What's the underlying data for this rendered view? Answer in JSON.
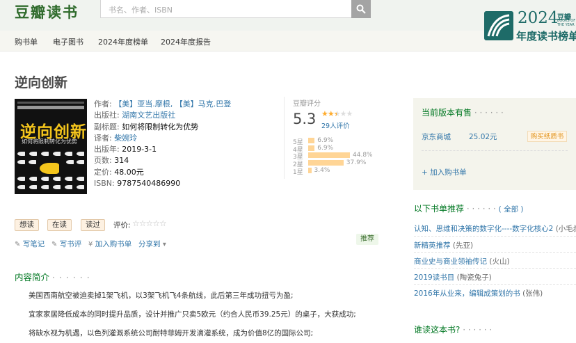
{
  "header": {
    "logo": "豆瓣读书",
    "search_placeholder": "书名、作者、ISBN",
    "nav": [
      "购书单",
      "电子图书",
      "2024年度榜单",
      "2024年度报告"
    ],
    "banner": {
      "year": "2024",
      "subtitle": "年度读书榜单",
      "brand": "豆瓣",
      "brand_sub": "BOOKS OF THE YEAR"
    }
  },
  "book": {
    "title": "逆向创新",
    "cover": {
      "title": "逆向创新",
      "subtitle": "如何将限制转化为优势"
    },
    "author_label": "作者:",
    "author": "【美】亚当.摩根, 【美】马克.巴登",
    "publisher_label": "出版社:",
    "publisher": "湖南文艺出版社",
    "subtitle_label": "副标题:",
    "subtitle": "如何将限制转化为优势",
    "translator_label": "译者:",
    "translator": "柴婉玲",
    "pubdate_label": "出版年:",
    "pubdate": "2019-3-1",
    "pages_label": "页数:",
    "pages": "314",
    "price_label": "定价:",
    "price": "48.00元",
    "isbn_label": "ISBN:",
    "isbn": "9787540486990"
  },
  "rating": {
    "title": "豆瓣评分",
    "score": "5.3",
    "stars_value": 2.5,
    "count": "29人评价",
    "distribution": [
      {
        "label": "5星",
        "value": 6.9,
        "pct": "6.9%"
      },
      {
        "label": "4星",
        "value": 6.9,
        "pct": "6.9%"
      },
      {
        "label": "3星",
        "value": 44.8,
        "pct": "44.8%"
      },
      {
        "label": "2星",
        "value": 37.9,
        "pct": "37.9%"
      },
      {
        "label": "1星",
        "value": 3.4,
        "pct": "3.4%"
      }
    ]
  },
  "actions": {
    "want": "想读",
    "reading": "在读",
    "read": "读过",
    "rate_label": "评价:",
    "write_note": "写笔记",
    "write_review": "写书评",
    "add_list": "加入购书单",
    "share": "分享到",
    "recommend": "推荐"
  },
  "intro": {
    "title": "内容简介",
    "dots": "· · · · · ·",
    "paragraphs": [
      "美国西南航空被迫卖掉1架飞机，以3架飞机飞4条航线，此后第三年成功扭亏为盈;",
      "宜家家居降低成本的同时提升品质，设计并推广只卖5欧元（约合人民币39.25元）的桌子，大获成功;",
      "将缺水视为机遇，以色列灌溉系统公司耐特菲姆开发滴灌系统，成为价值8亿的国际公司;"
    ]
  },
  "buy": {
    "title": "当前版本有售",
    "dots": "· · · · · ·",
    "store": "京东商城",
    "price": "25.02元",
    "button": "购买纸质书",
    "add": "+ 加入购书单"
  },
  "lists": {
    "title": "以下书单推荐",
    "dots": "· · · · · ·",
    "all": "( 全部 )",
    "items": [
      {
        "name": "认知、思维和决策的数字化----数字化核心2",
        "who": "(小毛叔)"
      },
      {
        "name": "新精英推荐",
        "who": "(先亚)"
      },
      {
        "name": "商业史与商业领袖传记",
        "who": "(火山)"
      },
      {
        "name": "2019读书目",
        "who": "(陶瓷兔子)"
      },
      {
        "name": "2016年从业来，编辑成策划的书",
        "who": "(张伟)"
      }
    ]
  },
  "who_reads": {
    "title": "谁读这本书?",
    "dots": "· · · · · ·"
  },
  "colors": {
    "green": "#007722",
    "link": "#3377aa",
    "star": "#ffac2d",
    "bar": "#ffd596"
  }
}
